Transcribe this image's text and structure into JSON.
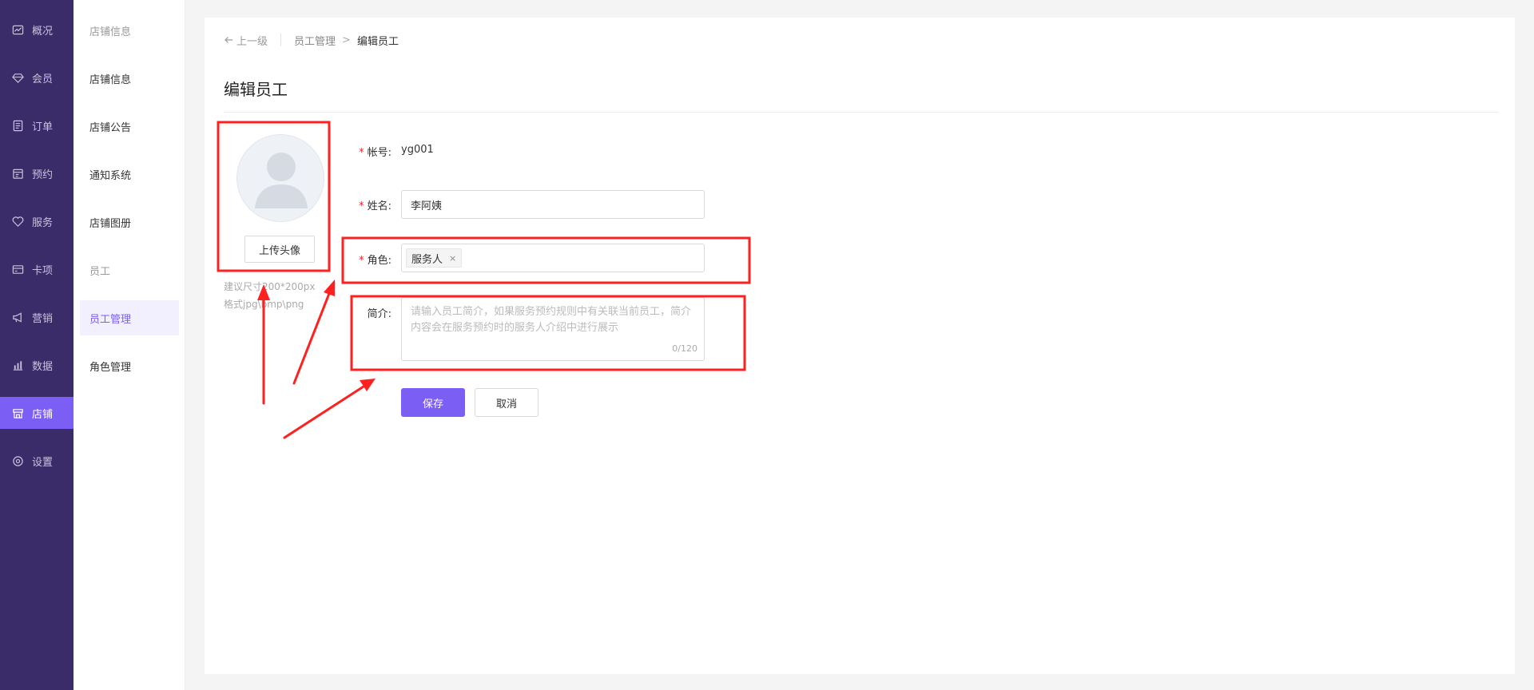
{
  "nav": {
    "items": [
      {
        "label": "概况",
        "icon": "dashboard-icon"
      },
      {
        "label": "会员",
        "icon": "diamond-icon"
      },
      {
        "label": "订单",
        "icon": "order-icon"
      },
      {
        "label": "预约",
        "icon": "calendar-icon"
      },
      {
        "label": "服务",
        "icon": "heart-icon"
      },
      {
        "label": "卡项",
        "icon": "card-icon"
      },
      {
        "label": "营销",
        "icon": "megaphone-icon"
      },
      {
        "label": "数据",
        "icon": "chart-icon"
      },
      {
        "label": "店铺",
        "icon": "store-icon",
        "active": true
      },
      {
        "label": "设置",
        "icon": "settings-icon"
      }
    ],
    "active_color": "#7b5ff5",
    "bg_color": "#3a2c69"
  },
  "submenu": {
    "group1": "店铺信息",
    "items1": [
      "店铺信息",
      "店铺公告",
      "通知系统",
      "店铺图册"
    ],
    "group2": "员工",
    "items2": [
      "员工管理",
      "角色管理"
    ],
    "active": "员工管理"
  },
  "breadcrumb": {
    "back": "上一级",
    "parent": "员工管理",
    "separator": ">",
    "current": "编辑员工"
  },
  "page_title": "编辑员工",
  "avatar": {
    "upload_label": "上传头像",
    "hint_line1": "建议尺寸200*200px",
    "hint_line2": "格式jpg\\bmp\\png"
  },
  "form": {
    "account": {
      "label": "帐号:",
      "value": "yg001",
      "required": true
    },
    "name": {
      "label": "姓名:",
      "value": "李阿姨",
      "required": true
    },
    "role": {
      "label": "角色:",
      "tag": "服务人",
      "tag_close": "×",
      "required": true
    },
    "intro": {
      "label": "简介:",
      "placeholder": "请输入员工简介，如果服务预约规则中有关联当前员工，简介内容会在服务预约时的服务人介绍中进行展示",
      "counter": "0/120"
    },
    "save_label": "保存",
    "cancel_label": "取消"
  },
  "annotation_color": "#ff2020"
}
